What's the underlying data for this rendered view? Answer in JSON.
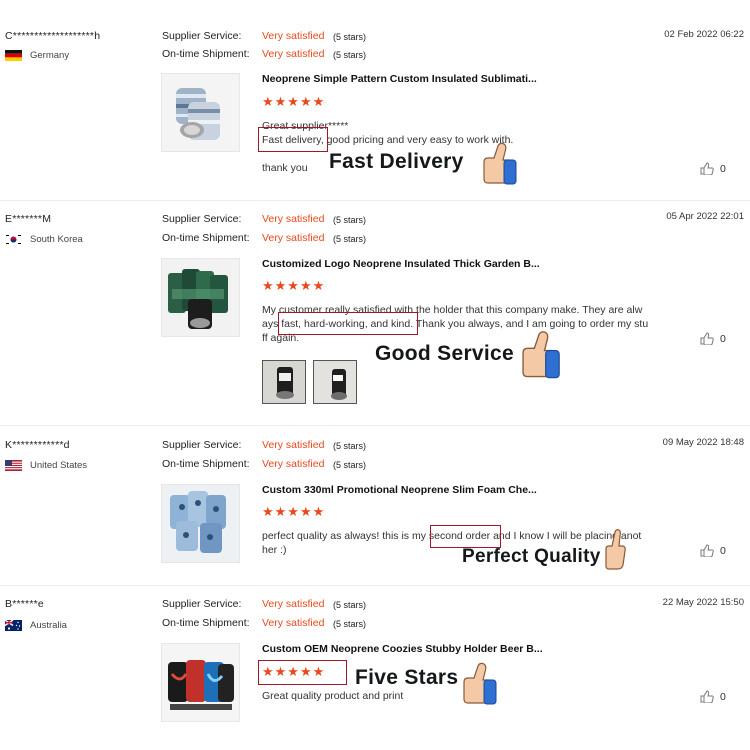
{
  "labels": {
    "supplier_service": "Supplier Service:",
    "ontime_shipment": "On-time Shipment:",
    "rating_value": "Very satisfied",
    "rating_note": "(5 stars)"
  },
  "stars": "★★★★★",
  "reviews": [
    {
      "buyer": "C*******************h",
      "country": "Germany",
      "flag": "germany",
      "date": "02 Feb 2022 06:22",
      "product": "Neoprene Simple Pattern Custom Insulated Sublimati...",
      "text_lines": [
        "Great supplier*****",
        "Fast delivery, good pricing and very easy to work with.",
        "",
        "thank you"
      ],
      "likes": "0",
      "callout": "Fast Delivery"
    },
    {
      "buyer": "E*******M",
      "country": "South Korea",
      "flag": "korea",
      "date": "05 Apr 2022 22:01",
      "product": "Customized Logo Neoprene Insulated Thick Garden B...",
      "text_lines": [
        "My customer really satisfied with the holder that this company make. They are alw",
        "ays fast, hard-working, and kind. Thank you always, and I am going to order my stu",
        "ff again."
      ],
      "likes": "0",
      "callout": "Good Service"
    },
    {
      "buyer": "K************d",
      "country": "United States",
      "flag": "usa",
      "date": "09 May 2022 18:48",
      "product": "Custom 330ml Promotional Neoprene Slim Foam Che...",
      "text_lines": [
        "perfect quality as always! this is my second order and I know I will be placing anot",
        "her :)"
      ],
      "likes": "0",
      "callout": "Perfect Quality"
    },
    {
      "buyer": "B******e",
      "country": "Australia",
      "flag": "australia",
      "date": "22 May 2022 15:50",
      "product": "Custom OEM Neoprene Coozies Stubby Holder Beer B...",
      "text_lines": [
        "Great quality product and print"
      ],
      "likes": "0",
      "callout": "Five Stars"
    }
  ]
}
